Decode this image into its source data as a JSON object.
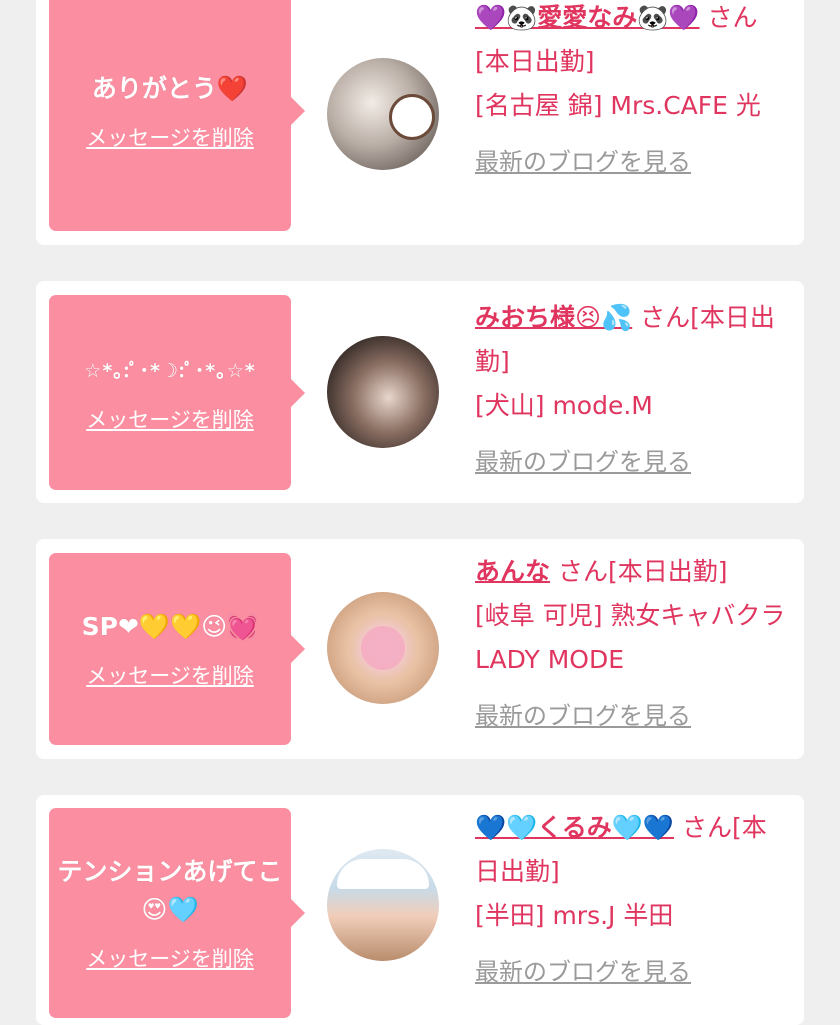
{
  "cards": [
    {
      "message": "ありがとう❤️",
      "delete_label": "メッセージを削除",
      "cast_name": "💜🐼愛愛なみ🐼💜",
      "suffix": "さん[本日出勤]",
      "shop": "[名古屋 錦] Mrs.CAFE 光",
      "blog_label": "最新のブログを見る"
    },
    {
      "message": "☆*｡:ﾟ･*☽:ﾟ･*｡☆*",
      "delete_label": "メッセージを削除",
      "cast_name": "みおち様😣💦",
      "suffix": "さん[本日出勤]",
      "shop": "[犬山] mode.M",
      "blog_label": "最新のブログを見る"
    },
    {
      "message": "SP❤💛💛😉💓",
      "delete_label": "メッセージを削除",
      "cast_name": "あんな",
      "suffix": "さん[本日出勤]",
      "shop": "[岐阜 可児] 熟女キャバクラ LADY MODE",
      "blog_label": "最新のブログを見る"
    },
    {
      "message": "テンションあげてこ😍🩵",
      "delete_label": "メッセージを削除",
      "cast_name": "💙🩵くるみ🩵💙",
      "suffix": "さん[本日出勤]",
      "shop": "[半田] mrs.J 半田",
      "blog_label": "最新のブログを見る"
    }
  ],
  "colors": {
    "bubble": "#fb8fa1",
    "accent_text": "#e0355f",
    "link_gray": "#9a9a9a",
    "page_bg": "#efefef"
  }
}
